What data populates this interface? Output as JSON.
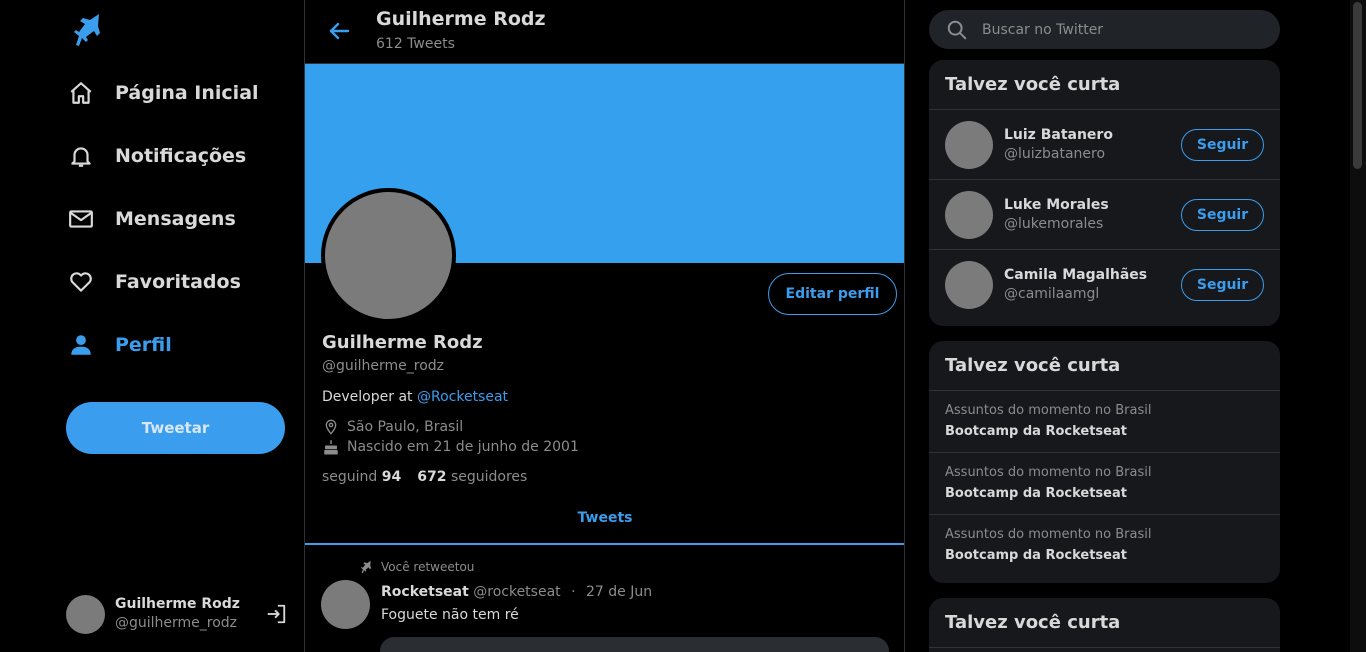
{
  "sidebar": {
    "nav": [
      {
        "label": "Página Inicial",
        "icon": "home-icon"
      },
      {
        "label": "Notificações",
        "icon": "bell-icon"
      },
      {
        "label": "Mensagens",
        "icon": "mail-icon"
      },
      {
        "label": "Favoritados",
        "icon": "heart-icon"
      },
      {
        "label": "Perfil",
        "icon": "person-icon"
      }
    ],
    "tweet_button": "Tweetar",
    "me": {
      "name": "Guilherme Rodz",
      "handle": "@guilherme_rodz"
    }
  },
  "header": {
    "title": "Guilherme Rodz",
    "subtitle": "612 Tweets"
  },
  "profile": {
    "edit_button": "Editar perfil",
    "name": "Guilherme Rodz",
    "handle": "@guilherme_rodz",
    "bio_prefix": "Developer at ",
    "bio_link": "@Rocketseat",
    "location": "São Paulo, Brasil",
    "birthday": "Nascido em 21 de junho de 2001",
    "following_label": "seguind",
    "following_count": "94",
    "followers_count": "672",
    "followers_label": "seguidores"
  },
  "tabs": {
    "tweets": "Tweets"
  },
  "tweet": {
    "retweet_note": "Você retweetou",
    "author": "Rocketseat",
    "handle": "@rocketseat",
    "dot": "·",
    "date": "27 de Jun",
    "text": "Foguete não tem ré"
  },
  "search": {
    "placeholder": "Buscar no Twitter"
  },
  "who_to_follow": {
    "title": "Talvez você curta",
    "follow_label": "Seguir",
    "users": [
      {
        "name": "Luiz Batanero",
        "handle": "@luizbatanero"
      },
      {
        "name": "Luke Morales",
        "handle": "@lukemorales"
      },
      {
        "name": "Camila Magalhães",
        "handle": "@camilaamgl"
      }
    ]
  },
  "trends": {
    "title": "Talvez você curta",
    "items": [
      {
        "context": "Assuntos do momento no Brasil",
        "topic": "Bootcamp da Rocketseat"
      },
      {
        "context": "Assuntos do momento no Brasil",
        "topic": "Bootcamp da Rocketseat"
      },
      {
        "context": "Assuntos do momento no Brasil",
        "topic": "Bootcamp da Rocketseat"
      }
    ]
  },
  "third_card": {
    "title": "Talvez você curta"
  },
  "colors": {
    "accent": "#3b9ded",
    "banner": "#35a0ee",
    "background": "#000000",
    "card": "#16181c"
  }
}
